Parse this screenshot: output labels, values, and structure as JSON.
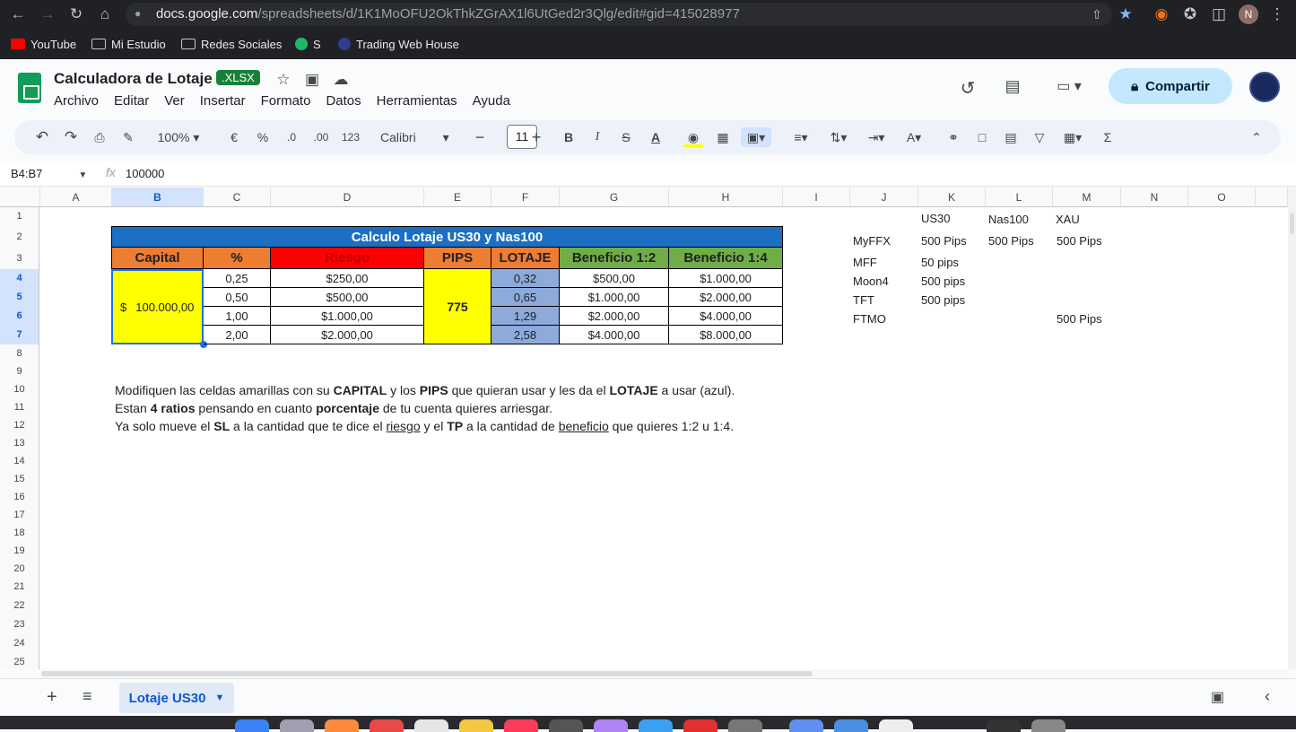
{
  "browser": {
    "url_domain": "docs.google.com",
    "url_path": "/spreadsheets/d/1K1MoOFU2OkThkZGrAX1l6UtGed2r3Qlg/edit#gid=415028977",
    "bookmarks": [
      "YouTube",
      "Mi Estudio",
      "Redes Sociales",
      "S",
      "Trading Web House"
    ],
    "profile_initial": "N"
  },
  "sheet": {
    "title": "Calculadora de Lotaje",
    "format_badge": ".XLSX",
    "menu": [
      "Archivo",
      "Editar",
      "Ver",
      "Insertar",
      "Formato",
      "Datos",
      "Herramientas",
      "Ayuda"
    ],
    "share_label": "Compartir",
    "zoom": "100%",
    "currency": "€",
    "percent": "%",
    "dec_minus": ".0",
    "dec_plus": ".00",
    "num_format": "123",
    "font": "Calibri",
    "font_size": "11"
  },
  "formula_bar": {
    "name_box": "B4:B7",
    "fx": "fx",
    "value": "100000"
  },
  "columns": [
    "A",
    "B",
    "C",
    "D",
    "E",
    "F",
    "G",
    "H",
    "I",
    "J",
    "K",
    "L",
    "M",
    "N",
    "O"
  ],
  "rows": [
    "1",
    "2",
    "3",
    "4",
    "5",
    "6",
    "7",
    "8",
    "9",
    "10",
    "11",
    "12",
    "13",
    "14",
    "15",
    "16",
    "17",
    "18",
    "19",
    "20",
    "21",
    "22",
    "23",
    "24",
    "25"
  ],
  "table": {
    "title": "Calculo Lotaje US30 y Nas100",
    "headers": [
      "Capital",
      "%",
      "Riesgo",
      "PIPS",
      "LOTAJE",
      "Beneficio 1:2",
      "Beneficio 1:4"
    ],
    "capital_symbol": "$",
    "capital_amount": "100.000,00",
    "pips": "775",
    "rows": [
      {
        "pct": "0,25",
        "riesgo": "$250,00",
        "lotaje": "0,32",
        "b12": "$500,00",
        "b14": "$1.000,00"
      },
      {
        "pct": "0,50",
        "riesgo": "$500,00",
        "lotaje": "0,65",
        "b12": "$1.000,00",
        "b14": "$2.000,00"
      },
      {
        "pct": "1,00",
        "riesgo": "$1.000,00",
        "lotaje": "1,29",
        "b12": "$2.000,00",
        "b14": "$4.000,00"
      },
      {
        "pct": "2,00",
        "riesgo": "$2.000,00",
        "lotaje": "2,58",
        "b12": "$4.000,00",
        "b14": "$8.000,00"
      }
    ]
  },
  "side_table": {
    "headers": [
      "US30",
      "Nas100",
      "XAU"
    ],
    "rows": [
      {
        "name": "MyFFX",
        "us30": "500 Pips",
        "nas": "500 Pips",
        "xau": "500 Pips"
      },
      {
        "name": "MFF",
        "us30": "50 pips",
        "nas": "",
        "xau": ""
      },
      {
        "name": "Moon4",
        "us30": "500 pips",
        "nas": "",
        "xau": ""
      },
      {
        "name": "TFT",
        "us30": "500 pips",
        "nas": "",
        "xau": ""
      },
      {
        "name": "FTMO",
        "us30": "",
        "nas": "",
        "xau": "500 Pips"
      }
    ]
  },
  "notes": {
    "l1": [
      "Modifiquen las celdas amarillas con su ",
      "CAPITAL",
      " y los ",
      "PIPS",
      " que quieran usar y les da el ",
      "LOTAJE",
      " a usar (azul)."
    ],
    "l2": [
      "Estan ",
      "4 ratios",
      " pensando en cuanto ",
      "porcentaje",
      " de tu cuenta quieres arriesgar."
    ],
    "l3": [
      "Ya solo mueve el ",
      "SL",
      " a la cantidad que te dice el ",
      "riesgo",
      " y el ",
      "TP",
      " a la cantidad de ",
      "beneficio",
      " que quieres 1:2 u 1:4."
    ]
  },
  "sheet_tab": "Lotaje US30",
  "colors": {
    "title_bg": "#1c6fc2",
    "capital_hdr": "#ed7d31",
    "riesgo_hdr": "#ff0000",
    "pips_hdr": "#ed7d31",
    "lotaje_hdr": "#ed7d31",
    "benef_hdr": "#70ad47",
    "yellow": "#ffff00",
    "blue_cell": "#8eaadb"
  },
  "icons": [
    "back-icon",
    "forward-icon",
    "reload-icon",
    "home-icon",
    "lock-icon",
    "star-icon",
    "undo-icon",
    "redo-icon",
    "print-icon",
    "paint-format-icon",
    "bold-icon",
    "italic-icon",
    "strikethrough-icon",
    "text-color-icon",
    "fill-color-icon",
    "borders-icon",
    "merge-icon",
    "align-icon",
    "valign-icon",
    "wrap-icon",
    "rotate-icon",
    "link-icon",
    "comment-icon",
    "chart-icon",
    "filter-icon",
    "views-icon",
    "functions-icon",
    "history-icon",
    "chat-icon",
    "meet-icon"
  ]
}
